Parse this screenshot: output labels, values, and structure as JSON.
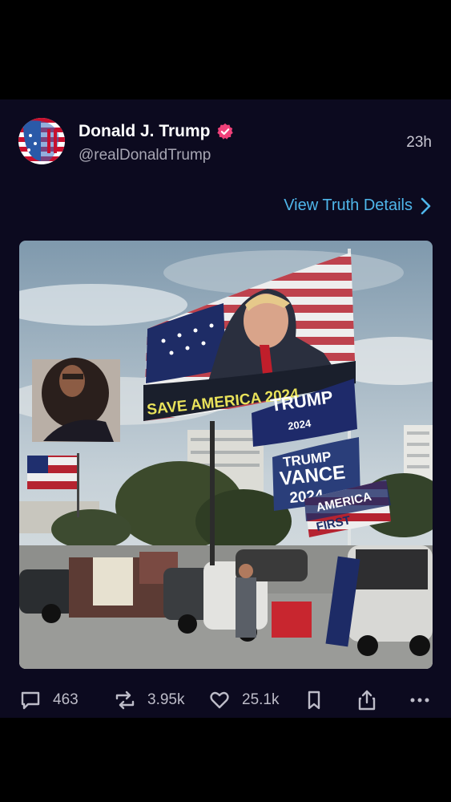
{
  "post": {
    "author": {
      "display_name": "Donald J. Trump",
      "handle": "@realDonaldTrump",
      "verified_icon": "verified-badge-icon",
      "verified_color": "#f0417a"
    },
    "time_ago": "23h",
    "view_details_label": "View Truth Details",
    "image": {
      "banner_flag_text": "SAVE AMERICA 2024",
      "flag_trump": "TRUMP",
      "flag_trump_year": "2024",
      "flag_vance_1": "TRUMP",
      "flag_vance_2": "VANCE",
      "flag_vance_3": "2024",
      "flag_america": "AMERICA",
      "flag_first": "FIRST"
    }
  },
  "actions": {
    "replies": {
      "icon": "comment-icon",
      "count": "463"
    },
    "retruths": {
      "icon": "retruth-icon",
      "count": "3.95k"
    },
    "likes": {
      "icon": "heart-icon",
      "count": "25.1k"
    },
    "bookmark": {
      "icon": "bookmark-icon"
    },
    "share": {
      "icon": "share-icon"
    },
    "more": {
      "icon": "more-icon"
    }
  },
  "colors": {
    "background": "#0c0a1f",
    "accent_link": "#4fb6ea",
    "secondary_text": "#a7a6b3"
  }
}
